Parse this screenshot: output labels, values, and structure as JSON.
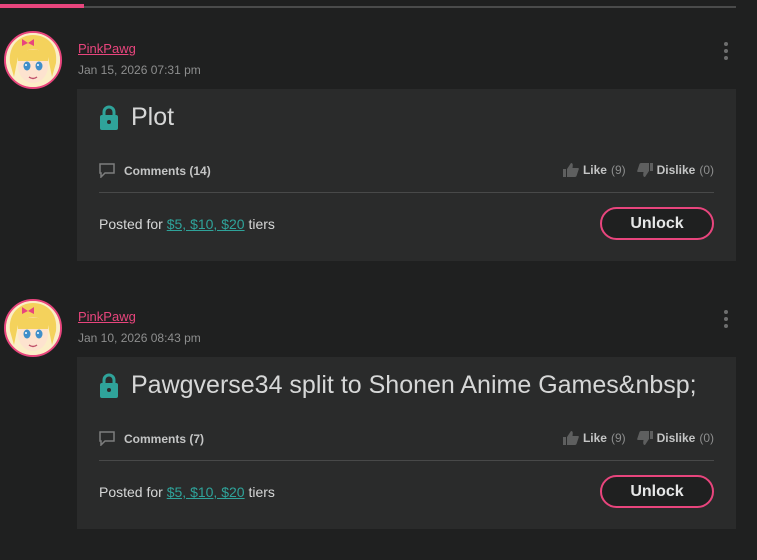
{
  "posts": [
    {
      "author": "PinkPawg",
      "date": "Jan 15, 2026 07:31 pm",
      "title": "Plot",
      "comments": "Comments (14)",
      "like_label": "Like",
      "like_count": "(9)",
      "dislike_label": "Dislike",
      "dislike_count": "(0)",
      "posted_for_prefix": "Posted for",
      "tiers": "$5, $10, $20",
      "tiers_suffix": "tiers",
      "unlock_label": "Unlock"
    },
    {
      "author": "PinkPawg",
      "date": "Jan 10, 2026 08:43 pm",
      "title": "Pawgverse34 split to Shonen Anime Games&nbsp;",
      "comments": "Comments (7)",
      "like_label": "Like",
      "like_count": "(9)",
      "dislike_label": "Dislike",
      "dislike_count": "(0)",
      "posted_for_prefix": "Posted for",
      "tiers": "$5, $10, $20",
      "tiers_suffix": "tiers",
      "unlock_label": "Unlock"
    }
  ],
  "colors": {
    "accent": "#e8457d",
    "link": "#2fa39a",
    "lock": "#2fa39a",
    "background": "#1f2020",
    "card": "#2a2b2b"
  },
  "icons": [
    "lock-icon",
    "comment-icon",
    "thumbs-up-icon",
    "thumbs-down-icon",
    "more-vertical-icon"
  ]
}
